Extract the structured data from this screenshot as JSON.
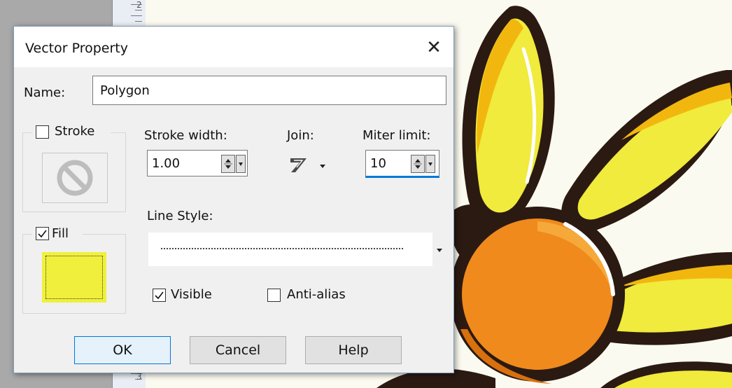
{
  "dialog": {
    "title": "Vector Property",
    "close_label": "✕",
    "name_label": "Name:",
    "name_value": "Polygon",
    "stroke_label": "Stroke",
    "stroke_checked": false,
    "fill_label": "Fill",
    "fill_checked": true,
    "fill_color": "#f0f03c",
    "stroke_width_label": "Stroke width:",
    "stroke_width_value": "1.00",
    "join_label": "Join:",
    "miter_limit_label": "Miter limit:",
    "miter_limit_value": "10",
    "line_style_label": "Line Style:",
    "visible_label": "Visible",
    "visible_checked": true,
    "anti_alias_label": "Anti-alias",
    "anti_alias_checked": false,
    "buttons": {
      "ok": "OK",
      "cancel": "Cancel",
      "help": "Help"
    }
  },
  "ruler": {
    "labels": [
      "2",
      "3"
    ]
  },
  "icons": {
    "stroke_preview": "no-symbol-icon",
    "join": "miter-join-icon",
    "dropdown": "triangle-down-icon",
    "close": "close-icon"
  },
  "colors": {
    "accent": "#0078d7",
    "petal_yellow": "#f0eb3c",
    "petal_dark": "#f2b70e",
    "flower_center": "#f08a1c",
    "outline": "#2b1a12"
  }
}
